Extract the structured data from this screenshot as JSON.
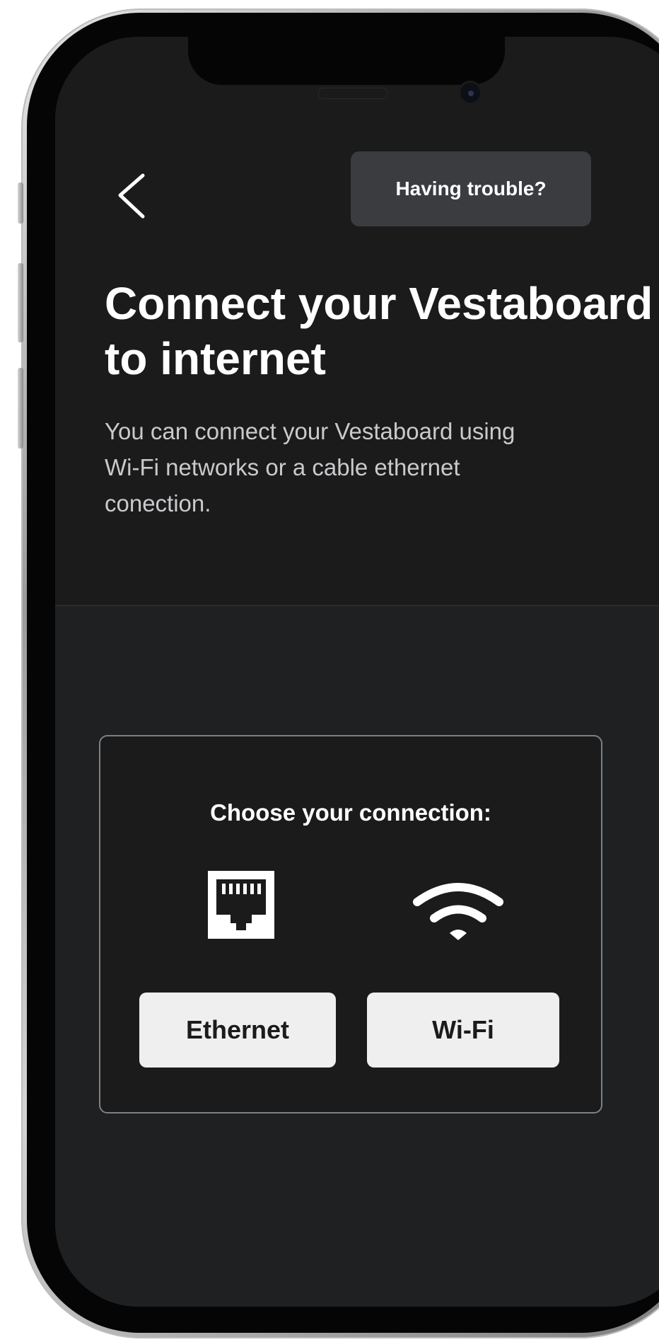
{
  "header": {
    "trouble_label": "Having trouble?"
  },
  "intro": {
    "title": "Connect your Vestaboard to internet",
    "description": "You can connect your Vestaboard using Wi-Fi networks or a cable ethernet conection."
  },
  "connection": {
    "heading": "Choose your connection:",
    "ethernet_label": "Ethernet",
    "wifi_label": "Wi-Fi"
  },
  "icons": {
    "back": "chevron-left-icon",
    "ethernet": "ethernet-port-icon",
    "wifi": "wifi-icon"
  },
  "colors": {
    "screen_background": "#1b1b1c",
    "button_dark": "#3a3c3f",
    "button_light": "#efefef",
    "text_primary": "#ffffff",
    "text_secondary": "#c9cacc"
  }
}
